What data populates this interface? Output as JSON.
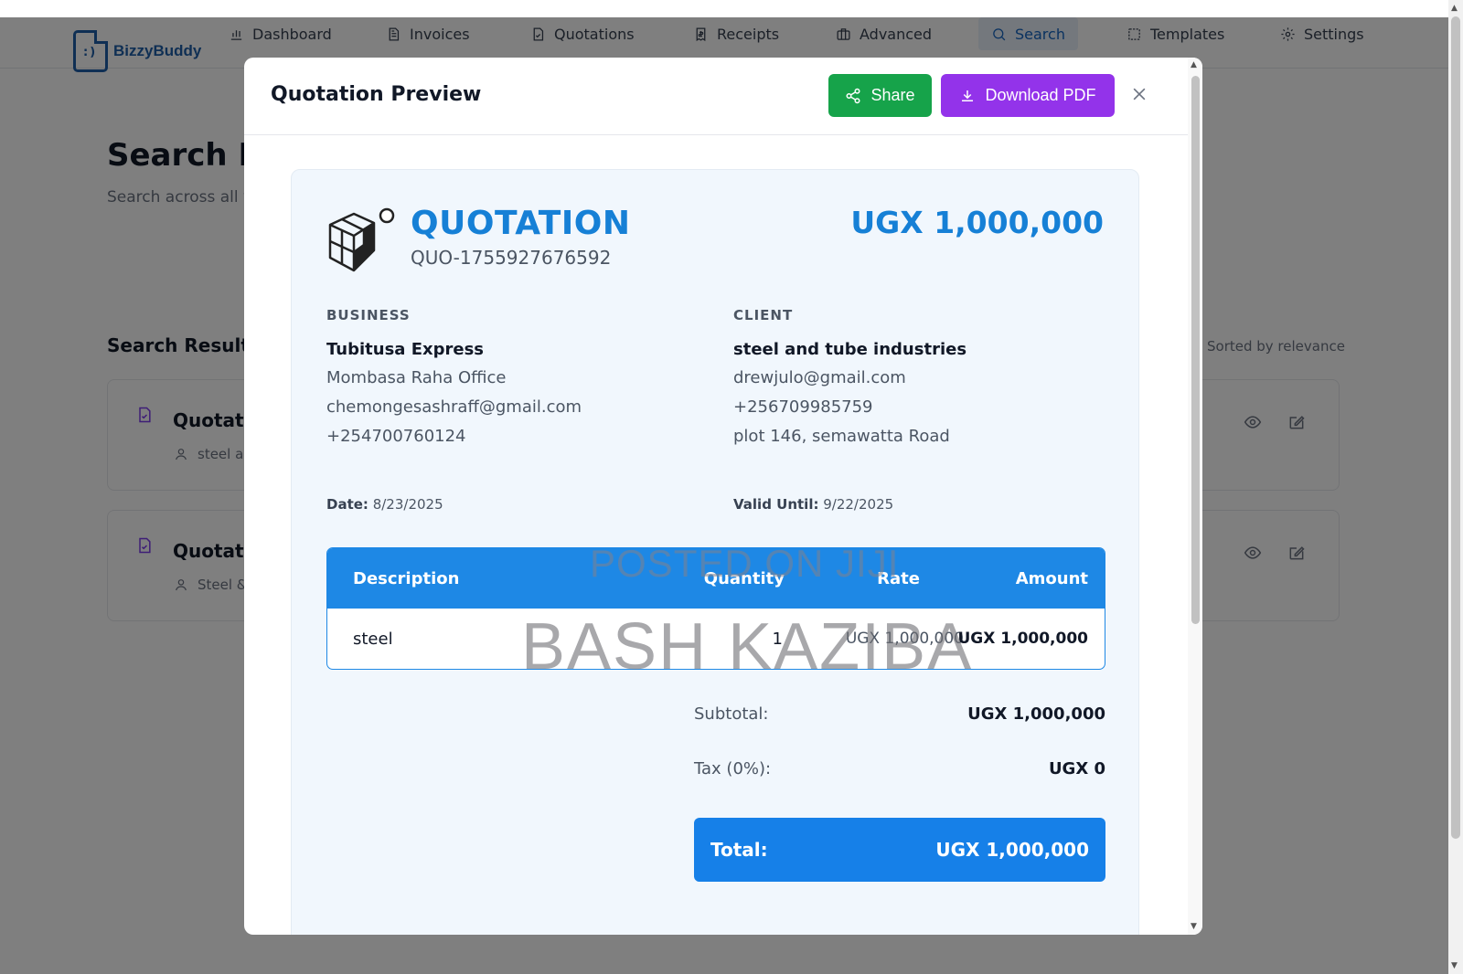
{
  "app": {
    "name": "BizzyBuddy",
    "nav": [
      {
        "label": "Dashboard",
        "icon": "bar-chart-icon"
      },
      {
        "label": "Invoices",
        "icon": "file-text-icon"
      },
      {
        "label": "Quotations",
        "icon": "file-check-icon"
      },
      {
        "label": "Receipts",
        "icon": "receipt-icon"
      },
      {
        "label": "Advanced",
        "icon": "briefcase-icon"
      },
      {
        "label": "Search",
        "icon": "search-icon",
        "active": true
      },
      {
        "label": "Templates",
        "icon": "layout-icon"
      },
      {
        "label": "Settings",
        "icon": "gear-icon"
      }
    ]
  },
  "page": {
    "title": "Search De",
    "subtitle": "Search across all y",
    "results_title": "Search Results",
    "sorted_label": "Sorted by relevance",
    "results": [
      {
        "title": "Quotati",
        "client": "steel a"
      },
      {
        "title": "Quotati",
        "client": "Steel &"
      }
    ]
  },
  "modal": {
    "title": "Quotation Preview",
    "share_label": "Share",
    "download_label": "Download PDF",
    "close_icon": "close-icon"
  },
  "quotation": {
    "heading": "QUOTATION",
    "number": "QUO-1755927676592",
    "total_top": "UGX 1,000,000",
    "business": {
      "label": "BUSINESS",
      "name": "Tubitusa Express",
      "address": "Mombasa Raha Office",
      "email": "chemongesashraff@gmail.com",
      "phone": "+254700760124"
    },
    "client": {
      "label": "CLIENT",
      "name": "steel and tube industries",
      "email": "drewjulo@gmail.com",
      "phone": "+256709985759",
      "address": "plot 146, semawatta Road"
    },
    "date_label": "Date:",
    "date": "8/23/2025",
    "valid_label": "Valid Until:",
    "valid_until": "9/22/2025",
    "columns": {
      "description": "Description",
      "quantity": "Quantity",
      "rate": "Rate",
      "amount": "Amount"
    },
    "items": [
      {
        "description": "steel",
        "quantity": "1",
        "rate": "UGX 1,000,000",
        "amount": "UGX 1,000,000"
      }
    ],
    "subtotal_label": "Subtotal:",
    "subtotal": "UGX 1,000,000",
    "tax_label": "Tax (0%):",
    "tax": "UGX 0",
    "total_label": "Total:",
    "total": "UGX 1,000,000"
  },
  "watermarks": {
    "top": "POSTED ON JIJI",
    "main": "BASH KAZIBA"
  },
  "colors": {
    "brand": "#1e5fa8",
    "accent_blue": "#1680e8",
    "share_green": "#16a34a",
    "pdf_purple": "#9333ea",
    "result_icon_purple": "#7c3aed"
  }
}
